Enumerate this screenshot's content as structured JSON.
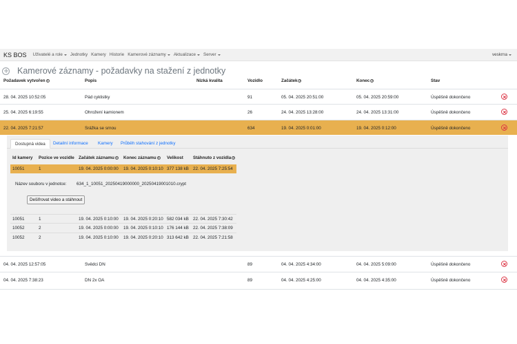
{
  "navbar": {
    "brand": "KS BOS",
    "items": [
      {
        "label": "Uživatelé a role",
        "dropdown": true
      },
      {
        "label": "Jednotky",
        "dropdown": false
      },
      {
        "label": "Kamery",
        "dropdown": false
      },
      {
        "label": "Historie",
        "dropdown": false
      },
      {
        "label": "Kamerové záznamy",
        "dropdown": true
      },
      {
        "label": "Aktualizace",
        "dropdown": true
      },
      {
        "label": "Server",
        "dropdown": true
      }
    ],
    "user": "veskrna"
  },
  "page": {
    "title": "Kamerové záznamy - požadavky na stažení z jednotky"
  },
  "table": {
    "headers": [
      "Požadavek vytvořen",
      "Popis",
      "Nízká kvalita",
      "Vozidlo",
      "Začátek",
      "Konec",
      "Stav"
    ],
    "rows": [
      {
        "created": "28. 04. 2025 10:52:05",
        "desc": "Pád cyklistky",
        "low": "",
        "vehicle": "91",
        "start": "05. 04. 2025 20:51:00",
        "end": "05. 04. 2025 20:59:00",
        "state": "Úspěšně dokončeno"
      },
      {
        "created": "25. 04. 2025 6:19:55",
        "desc": "Ohrožení kamionem",
        "low": "",
        "vehicle": "26",
        "start": "24. 04. 2025 13:28:00",
        "end": "24. 04. 2025 13:31:00",
        "state": "Úspěšně dokončeno"
      },
      {
        "created": "22. 04. 2025 7:21:57",
        "desc": "Srážka se srnou",
        "low": "",
        "vehicle": "634",
        "start": "19. 04. 2025 0:01:00",
        "end": "19. 04. 2025 0:12:00",
        "state": "Úspěšně dokončeno"
      },
      {
        "created": "04. 04. 2025 12:57:05",
        "desc": "Svědci DN",
        "low": "",
        "vehicle": "89",
        "start": "04. 04. 2025 4:34:00",
        "end": "04. 04. 2025 5:09:00",
        "state": "Úspěšně dokončeno"
      },
      {
        "created": "04. 04. 2025 7:38:23",
        "desc": "DN 2x OA",
        "low": "",
        "vehicle": "89",
        "start": "04. 04. 2025 4:25:00",
        "end": "04. 04. 2025 4:35:00",
        "state": "Úspěšně dokončeno"
      }
    ]
  },
  "detail": {
    "tabs": [
      "Dostupná videa",
      "Detailní informace",
      "Kamery",
      "Průběh stahování z jednotky"
    ],
    "cam_headers": [
      "Id kamery",
      "Pozice ve vozidle",
      "Začátek záznamu",
      "Konec záznamu",
      "Velikost",
      "Stáhnuto z vozidla"
    ],
    "selected": {
      "id": "10051",
      "pos": "1",
      "start": "19. 04. 2025 0:00:00",
      "end": "19. 04. 2025 0:10:10",
      "size": "377 138 kB",
      "downloaded": "22. 04. 2025 7:25:54"
    },
    "file_label": "Název souboru v jednotce:",
    "file_name": "634_1_10051_20250419000000_20250419001010.crypt",
    "decrypt_button": "Dešifrovat video a stáhnout",
    "rows": [
      {
        "id": "10051",
        "pos": "1",
        "start": "19. 04. 2025 0:10:00",
        "end": "19. 04. 2025 0:20:10",
        "size": "582 034 kB",
        "downloaded": "22. 04. 2025 7:30:42"
      },
      {
        "id": "10052",
        "pos": "2",
        "start": "19. 04. 2025 0:00:00",
        "end": "19. 04. 2025 0:10:10",
        "size": "176 144 kB",
        "downloaded": "22. 04. 2025 7:38:09"
      },
      {
        "id": "10052",
        "pos": "2",
        "start": "19. 04. 2025 0:10:00",
        "end": "19. 04. 2025 0:20:10",
        "size": "313 642 kB",
        "downloaded": "22. 04. 2025 7:21:58"
      }
    ]
  },
  "colors": {
    "selected_row": "#e8b04f",
    "delete_icon": "#dc3545",
    "link": "#0d6efd"
  },
  "icons": {
    "add": "plus-circle-icon",
    "info": "info-icon",
    "delete": "delete-icon",
    "dropdown": "caret-down-icon"
  }
}
